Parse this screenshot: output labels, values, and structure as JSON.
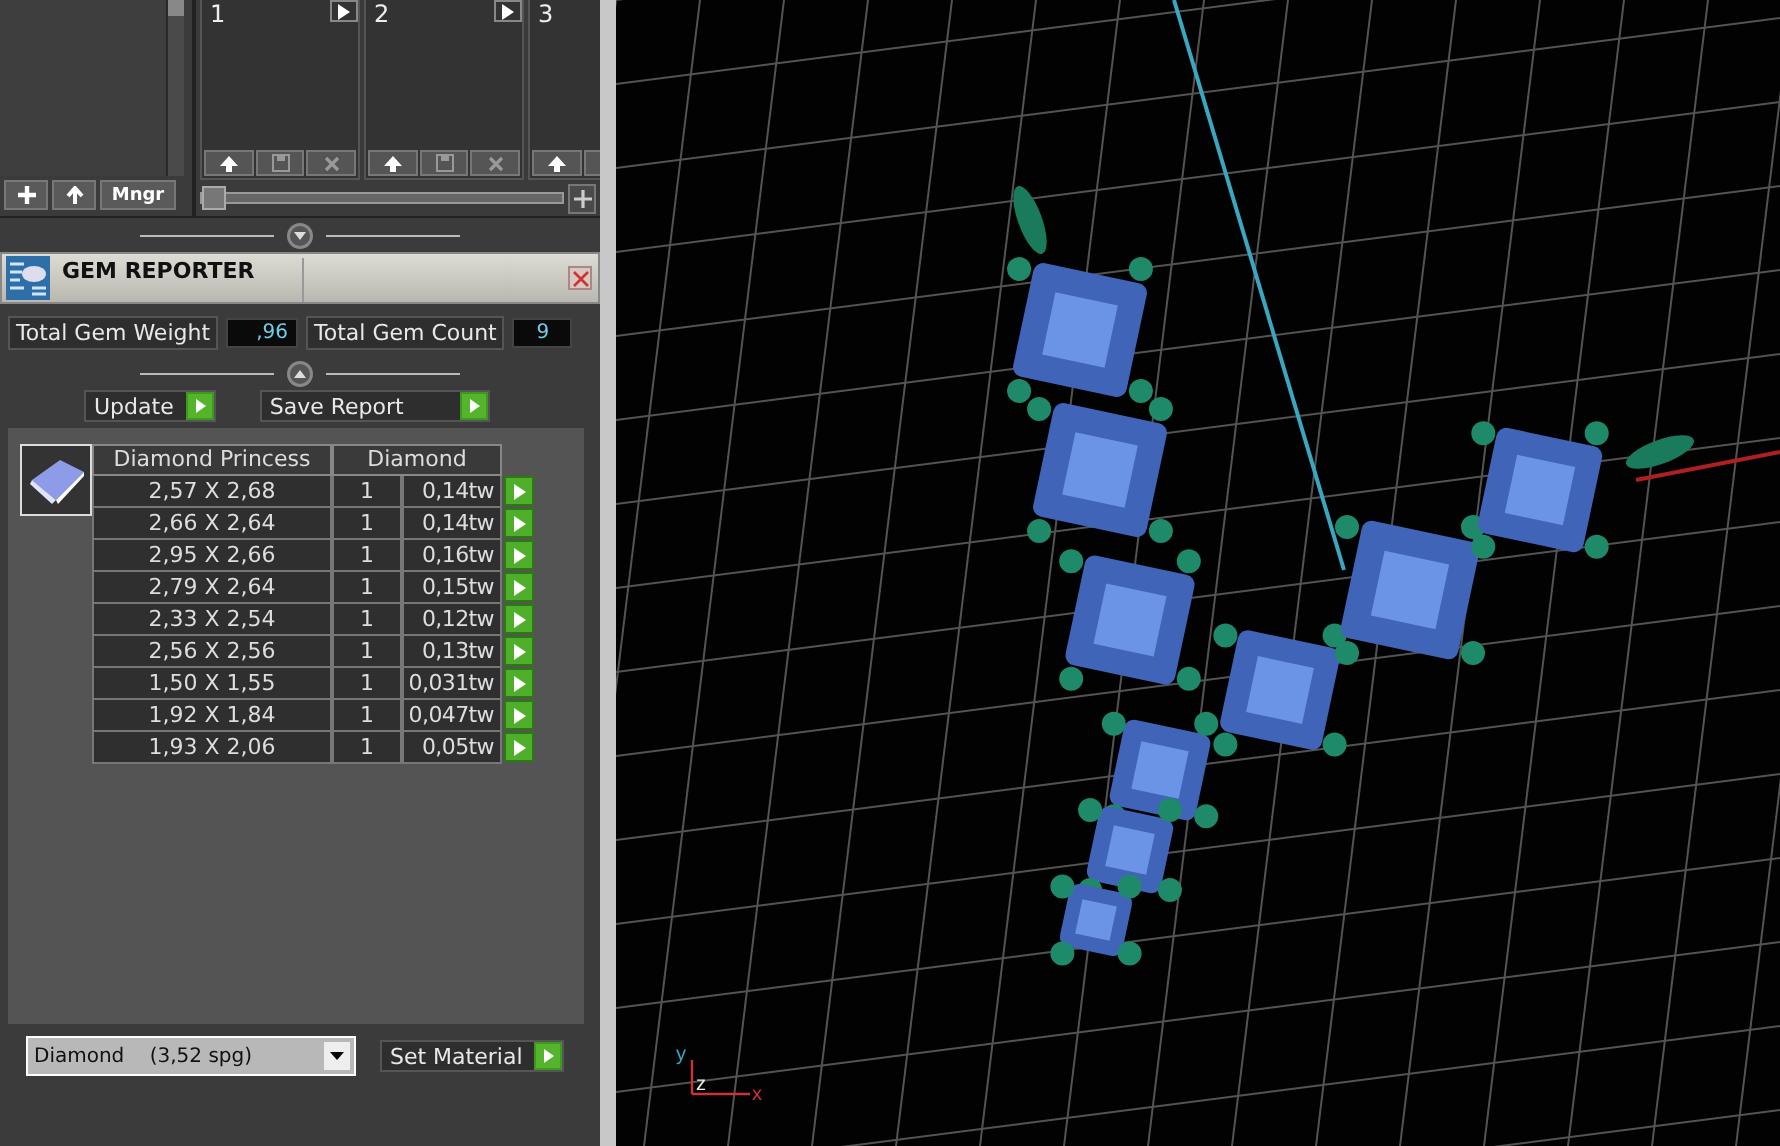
{
  "library": {
    "slider": {
      "level": 0
    },
    "slots": [
      {
        "label": "1"
      },
      {
        "label": "2"
      },
      {
        "label": "3"
      }
    ],
    "manager_button": "Mngr"
  },
  "panel": {
    "title": "GEM REPORTER"
  },
  "totals": [
    {
      "label": "Total Gem Weight",
      "value": ",96"
    },
    {
      "label": "Total Gem Count",
      "value": "9"
    }
  ],
  "actions": [
    "Update",
    "Save Report"
  ],
  "table": {
    "columns": [
      "Diamond Princess",
      "Diamond"
    ],
    "rows": [
      {
        "size": "2,57 X 2,68",
        "count": "1",
        "weight": "0,14tw"
      },
      {
        "size": "2,66 X 2,64",
        "count": "1",
        "weight": "0,14tw"
      },
      {
        "size": "2,95 X 2,66",
        "count": "1",
        "weight": "0,16tw"
      },
      {
        "size": "2,79 X 2,64",
        "count": "1",
        "weight": "0,15tw"
      },
      {
        "size": "2,33 X 2,54",
        "count": "1",
        "weight": "0,12tw"
      },
      {
        "size": "2,56 X 2,56",
        "count": "1",
        "weight": "0,13tw"
      },
      {
        "size": "1,50 X 1,55",
        "count": "1",
        "weight": "0,031tw"
      },
      {
        "size": "1,92 X 1,84",
        "count": "1",
        "weight": "0,047tw"
      },
      {
        "size": "1,93 X 2,06",
        "count": "1",
        "weight": "0,05tw"
      }
    ]
  },
  "material": {
    "value": "Diamond    (3,52 spg)",
    "button": "Set Material"
  },
  "viewport": {
    "axes": {
      "y": "y",
      "z": "z",
      "x": "x"
    }
  }
}
